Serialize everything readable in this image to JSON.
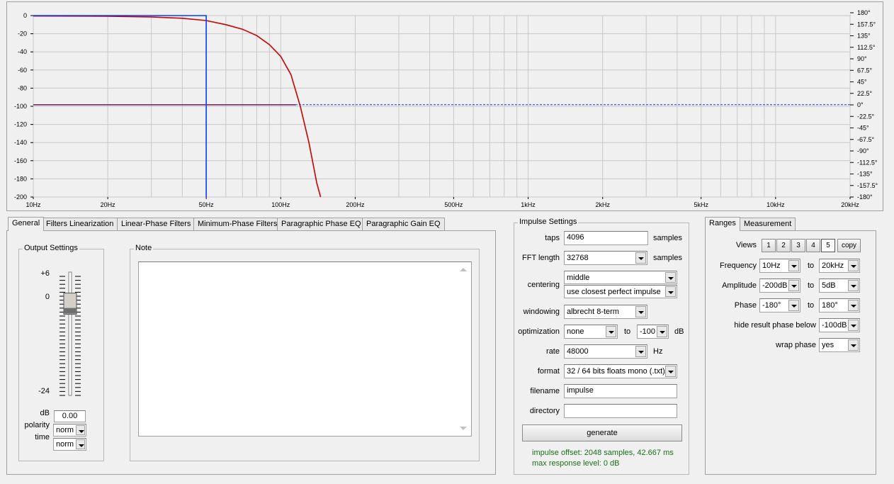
{
  "chart_data": {
    "type": "line",
    "x_scale": "log",
    "xlim": [
      10,
      20000
    ],
    "ylim": [
      -200,
      0
    ],
    "y2lim": [
      -180,
      180
    ],
    "grid": true,
    "x_ticks": [
      {
        "v": 10,
        "t": "10Hz"
      },
      {
        "v": 20,
        "t": "20Hz"
      },
      {
        "v": 50,
        "t": "50Hz"
      },
      {
        "v": 100,
        "t": "100Hz"
      },
      {
        "v": 200,
        "t": "200Hz"
      },
      {
        "v": 500,
        "t": "500Hz"
      },
      {
        "v": 1000,
        "t": "1kHz"
      },
      {
        "v": 2000,
        "t": "2kHz"
      },
      {
        "v": 5000,
        "t": "5kHz"
      },
      {
        "v": 10000,
        "t": "10kHz"
      },
      {
        "v": 20000,
        "t": "20kHz"
      }
    ],
    "y_ticks": [
      0,
      -20,
      -40,
      -60,
      -80,
      -100,
      -120,
      -140,
      -160,
      -180,
      -200
    ],
    "y2_ticks": [
      "180°",
      "157.5°",
      "135°",
      "112.5°",
      "90°",
      "67.5°",
      "45°",
      "22.5°",
      "0°",
      "-22.5°",
      "-45°",
      "-67.5°",
      "-90°",
      "-112.5°",
      "-135°",
      "-157.5°",
      "-180°"
    ],
    "series": [
      {
        "color": "#cc0000",
        "x": [
          10,
          20,
          30,
          40,
          50,
          60,
          70,
          80,
          90,
          100,
          110,
          120,
          130,
          140,
          145
        ],
        "y": [
          -0.5,
          -0.7,
          -1.5,
          -3,
          -5.5,
          -10,
          -15,
          -22,
          -32,
          -45,
          -65,
          -100,
          -140,
          -185,
          -200
        ]
      },
      {
        "color": "#0040ff",
        "x": [
          10,
          50,
          50
        ],
        "y": [
          0,
          0,
          -200
        ]
      },
      {
        "color": "#0040ff",
        "dashed": true,
        "x": [
          10,
          20000
        ],
        "y": [
          -98.3,
          -98.3
        ]
      },
      {
        "color": "#7b2a6a",
        "x": [
          10,
          115
        ],
        "y": [
          -98.3,
          -98.3
        ]
      }
    ]
  },
  "tabs": {
    "general": "General",
    "filters_linearization": "Filters Linearization",
    "linear_phase": "Linear-Phase Filters",
    "minimum_phase": "Minimum-Phase Filters",
    "paragraphic_phase": "Paragraphic Phase EQ",
    "paragraphic_gain": "Paragraphic Gain EQ"
  },
  "output_settings": {
    "title": "Output Settings",
    "scale_top": "+6",
    "scale_zero": "0",
    "scale_bottom": "-24",
    "db_label": "dB",
    "db_value": "0.00",
    "polarity_label": "polarity",
    "polarity_value": "norm",
    "time_label": "time",
    "time_value": "norm",
    "slider_level_db": 0
  },
  "note": {
    "title": "Note",
    "text": ""
  },
  "impulse": {
    "title": "Impulse Settings",
    "taps_label": "taps",
    "taps": "4096",
    "taps_unit": "samples",
    "fft_label": "FFT length",
    "fft": "32768",
    "fft_unit": "samples",
    "centering_label": "centering",
    "centering": "middle",
    "centering2": "use closest perfect impulse",
    "windowing_label": "windowing",
    "windowing": "albrecht 8-term",
    "optimization_label": "optimization",
    "optimization": "none",
    "to_label": "to",
    "optimization_to": "-100",
    "opt_unit": "dB",
    "rate_label": "rate",
    "rate": "48000",
    "rate_unit": "Hz",
    "format_label": "format",
    "format": "32 / 64 bits floats mono (.txt)",
    "filename_label": "filename",
    "filename": "impulse",
    "directory_label": "directory",
    "directory": "",
    "generate": "generate",
    "info1": "impulse offset: 2048 samples, 42.667 ms",
    "info2": "max response level: 0 dB"
  },
  "ranges": {
    "tab_ranges": "Ranges",
    "tab_measurement": "Measurement",
    "views_label": "Views",
    "views": [
      "1",
      "2",
      "3",
      "4",
      "5"
    ],
    "active_view": "5",
    "copy": "copy",
    "frequency_label": "Frequency",
    "freq_from": "10Hz",
    "freq_to": "20kHz",
    "amplitude_label": "Amplitude",
    "amp_from": "-200dB",
    "amp_to": "5dB",
    "phase_label": "Phase",
    "phase_from": "-180°",
    "phase_to": "180°",
    "hide_label": "hide result phase below",
    "hide_value": "-100dB",
    "wrap_label": "wrap phase",
    "wrap_value": "yes",
    "to": "to"
  }
}
